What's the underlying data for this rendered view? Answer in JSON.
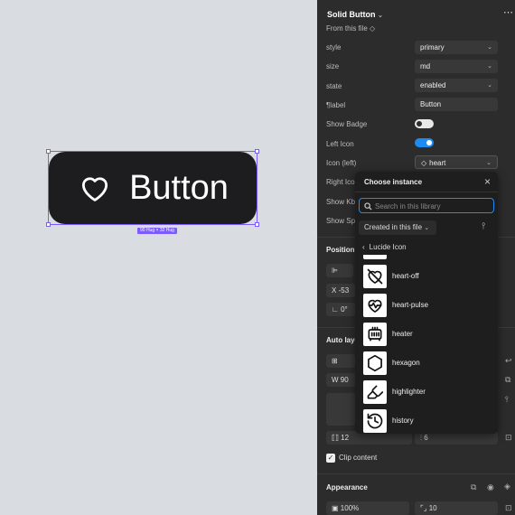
{
  "canvas": {
    "button_label": "Button",
    "dimension_badge": "90 Hug × 32 Hug"
  },
  "panel": {
    "title": "Solid Button",
    "from_file": "From this file",
    "props": {
      "style_label": "style",
      "style_value": "primary",
      "size_label": "size",
      "size_value": "md",
      "state_label": "state",
      "state_value": "enabled",
      "label_label": "label",
      "label_value": "Button",
      "show_badge_label": "Show Badge",
      "left_icon_label": "Left Icon",
      "icon_left_label": "Icon (left)",
      "icon_left_value": "heart",
      "right_icon_label": "Right Ico",
      "show_kb_label": "Show Kb",
      "show_sp_label": "Show Sp"
    },
    "position": {
      "title": "Position",
      "x_label": "X",
      "x_value": "-53",
      "rotation_value": "0°"
    },
    "auto_layout": {
      "title": "Auto layo",
      "w_label": "W",
      "w_value": "90",
      "padding_value": "12",
      "gap_value": "6"
    },
    "clip_content": "Clip content",
    "appearance": {
      "title": "Appearance",
      "opacity": "100%",
      "radius": "10"
    },
    "toggles": {
      "show_badge": false,
      "left_icon": true
    }
  },
  "popup": {
    "title": "Choose instance",
    "search_placeholder": "Search in this library",
    "filter": "Created in this file",
    "breadcrumb": "Lucide Icon",
    "items": [
      {
        "name": "heart-off",
        "icon": "heart-off-icon"
      },
      {
        "name": "heart-pulse",
        "icon": "heart-pulse-icon"
      },
      {
        "name": "heater",
        "icon": "heater-icon"
      },
      {
        "name": "hexagon",
        "icon": "hexagon-icon"
      },
      {
        "name": "highlighter",
        "icon": "highlighter-icon"
      },
      {
        "name": "history",
        "icon": "history-icon"
      }
    ]
  },
  "colors": {
    "accent": "#1c8cf5",
    "selection": "#7c5cff",
    "panel_bg": "#2c2c2c",
    "canvas_bg": "#d9dde2"
  }
}
